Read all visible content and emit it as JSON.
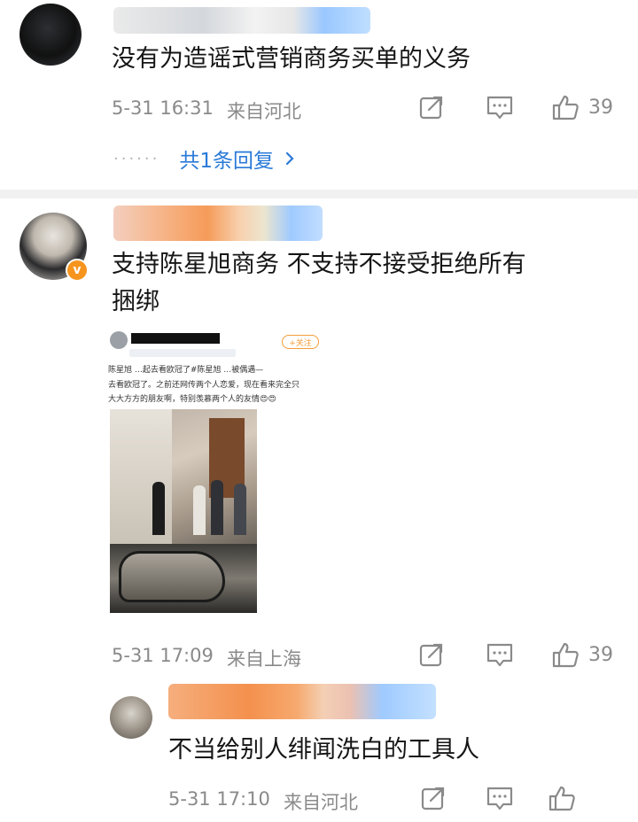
{
  "comments": [
    {
      "text": "没有为造谣式营销商务买单的义务",
      "time": "5-31 16:31",
      "location": "来自河北",
      "likes": "39",
      "replies_label": "共1条回复",
      "replies_dots": "······"
    },
    {
      "text_line1": "支持陈星旭商务 不支持不接受拒绝所有",
      "text_line2": "捆绑",
      "verified_badge": "v",
      "time": "5-31 17:09",
      "location": "来自上海",
      "likes": "39",
      "embed": {
        "follow_label": "+关注",
        "reply_line": "陈星旭 …起去看欧冠了#陈星旭 …被偶遇—",
        "body_line1": "去看欧冠了。之前还网传两个人恋爱，现在看来完全只",
        "body_line2": "大大方方的朋友啊，特别羡慕两个人的友情😍😍"
      }
    },
    {
      "text": "不当给别人绯闻洗白的工具人",
      "time": "5-31 17:10",
      "location": "来自河北"
    }
  ],
  "colors": {
    "link": "#2a7ad8",
    "meta": "#8a8a8a",
    "badge": "#f6941e"
  },
  "icons": [
    "share-icon",
    "comment-icon",
    "like-icon",
    "chevron-right-icon"
  ]
}
